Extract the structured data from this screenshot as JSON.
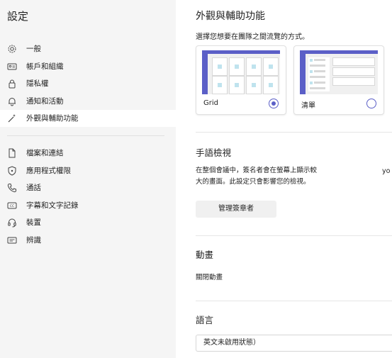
{
  "sidebar": {
    "title": "設定",
    "items_top": [
      {
        "label": "一般",
        "icon": "gear-icon"
      },
      {
        "label": "帳戶和組織",
        "icon": "id-card-icon"
      },
      {
        "label": "隱私權",
        "icon": "lock-icon"
      },
      {
        "label": "通知和活動",
        "icon": "bell-icon"
      },
      {
        "label": "外觀與輔助功能",
        "icon": "magic-wand-icon",
        "selected": true
      }
    ],
    "items_bottom": [
      {
        "label": "檔案和連結",
        "icon": "file-icon"
      },
      {
        "label": "應用程式權限",
        "icon": "shield-icon"
      },
      {
        "label": "通話",
        "icon": "phone-icon"
      },
      {
        "label": "字幕和文字記錄",
        "icon": "captions-icon"
      },
      {
        "label": "裝置",
        "icon": "headset-icon"
      },
      {
        "label": "辨識",
        "icon": "recognition-icon"
      }
    ]
  },
  "main": {
    "title": "外觀與輔助功能",
    "layout_subtitle": "選擇您想要在團隊之間流覽的方式。",
    "layout_options": [
      {
        "label": "Grid",
        "selected": true
      },
      {
        "label": "清單",
        "selected": false
      }
    ],
    "sign_language": {
      "heading": "手語檢視",
      "description_line1": "在整個會議中，簽名者會在螢幕上顯示較",
      "description_line2": "大的畫面。此設定只會影響您的檢視。",
      "cut_text": "yo",
      "button_label": "管理簽章者"
    },
    "animation": {
      "heading": "動畫",
      "option_label": "關閉動畫"
    },
    "language": {
      "heading": "語言",
      "select_value": "英文未啟用狀態）"
    }
  },
  "colors": {
    "accent": "#5b5fc7",
    "sidebar_bg": "#f5f5f5",
    "selected_bg": "#ffffff"
  }
}
